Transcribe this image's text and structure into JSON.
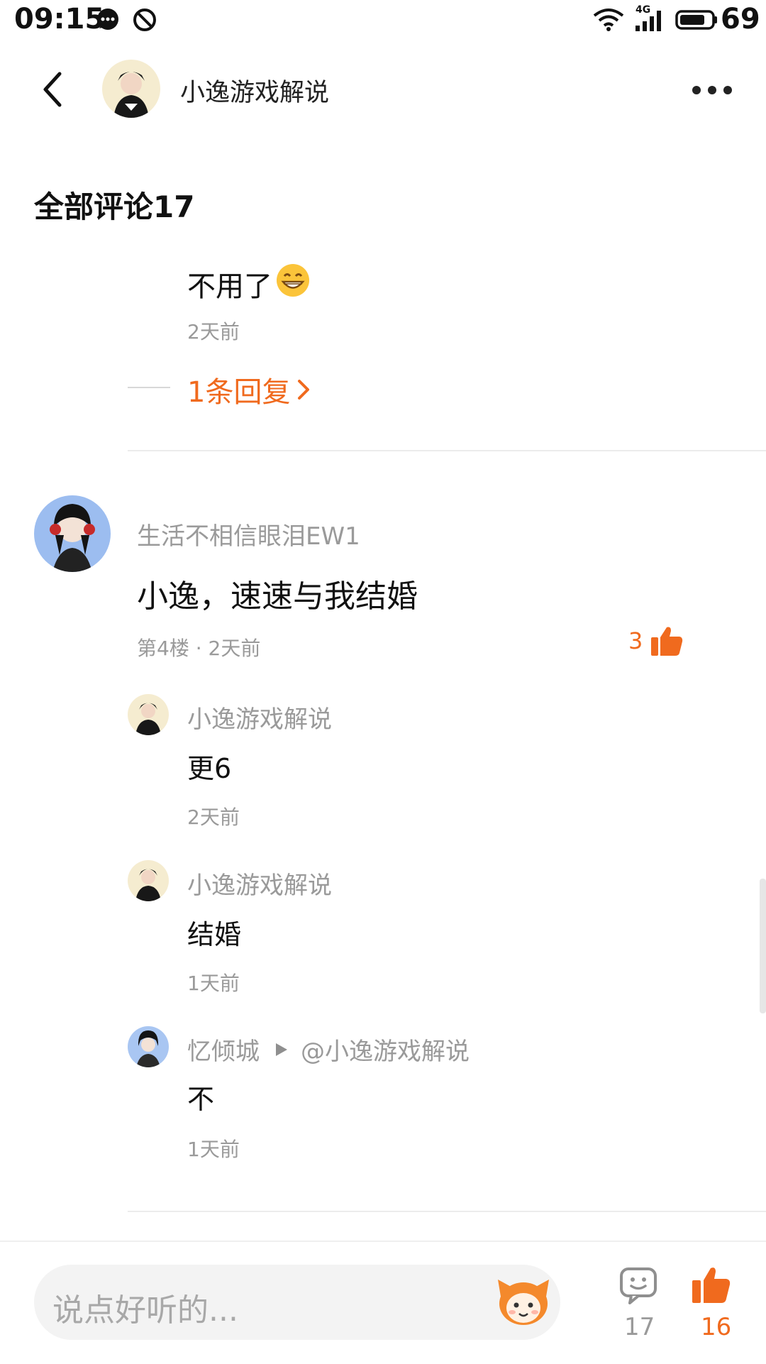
{
  "status_bar": {
    "time": "09:15",
    "network": "4G",
    "battery": "69"
  },
  "header": {
    "title": "小逸游戏解说"
  },
  "section": {
    "title": "全部评论17"
  },
  "top_reply": {
    "text": "不用了",
    "time": "2天前",
    "more_replies": "1条回复"
  },
  "comment": {
    "username": "生活不相信眼泪EW1",
    "text": "小逸，速速与我结婚",
    "meta": "第4楼 · 2天前",
    "likes": "3",
    "replies": [
      {
        "username": "小逸游戏解说",
        "text": "更6",
        "time": "2天前"
      },
      {
        "username": "小逸游戏解说",
        "text": "结婚",
        "time": "1天前"
      },
      {
        "username": "忆倾城",
        "reply_to": "@小逸游戏解说",
        "text": "不",
        "time": "1天前"
      }
    ]
  },
  "bottom_bar": {
    "input_placeholder": "说点好听的...",
    "comment_count": "17",
    "like_count": "16"
  },
  "colors": {
    "accent": "#f06a1e",
    "secondary_text": "#9a9a9a",
    "divider": "#ececec"
  }
}
